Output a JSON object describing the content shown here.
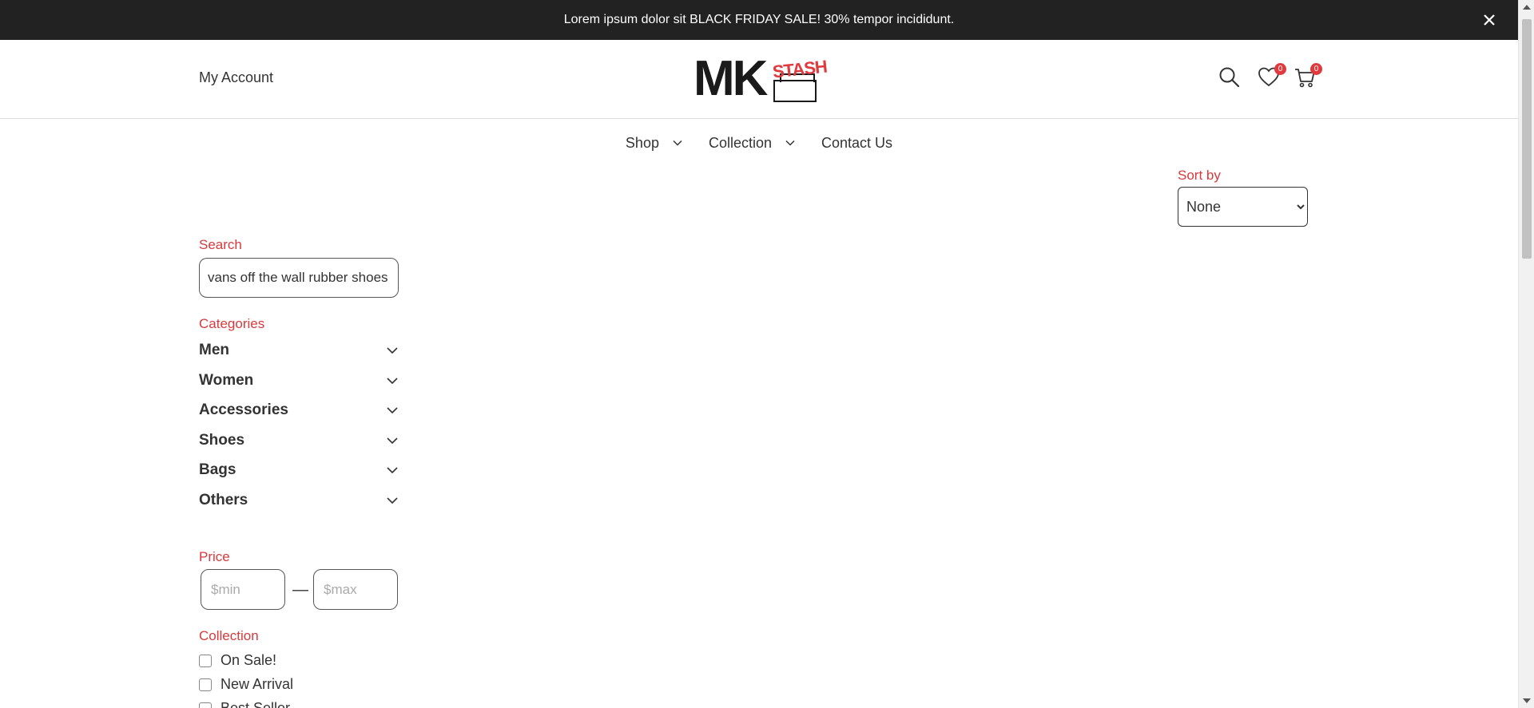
{
  "announcement": {
    "text": "Lorem ipsum dolor sit BLACK FRIDAY SALE! 30% tempor incididunt."
  },
  "header": {
    "my_account": "My Account",
    "logo": {
      "main": "MK",
      "accent": "STASH"
    },
    "wishlist_count": "0",
    "cart_count": "0"
  },
  "nav": {
    "items": [
      {
        "label": "Shop",
        "has_dropdown": true
      },
      {
        "label": "Collection",
        "has_dropdown": true
      },
      {
        "label": "Contact Us",
        "has_dropdown": false
      }
    ]
  },
  "sort": {
    "label": "Sort by",
    "selected": "None"
  },
  "filters": {
    "search_label": "Search",
    "search_value": "vans off the wall rubber shoes",
    "categories_label": "Categories",
    "categories": [
      "Men",
      "Women",
      "Accessories",
      "Shoes",
      "Bags",
      "Others"
    ],
    "price_label": "Price",
    "price_min_placeholder": "$min",
    "price_max_placeholder": "$max",
    "collection_label": "Collection",
    "collections": [
      "On Sale!",
      "New Arrival",
      "Best Seller"
    ]
  },
  "colors": {
    "accent": "#d9393d",
    "topbar": "#222222",
    "badge": "#e03a3e"
  }
}
